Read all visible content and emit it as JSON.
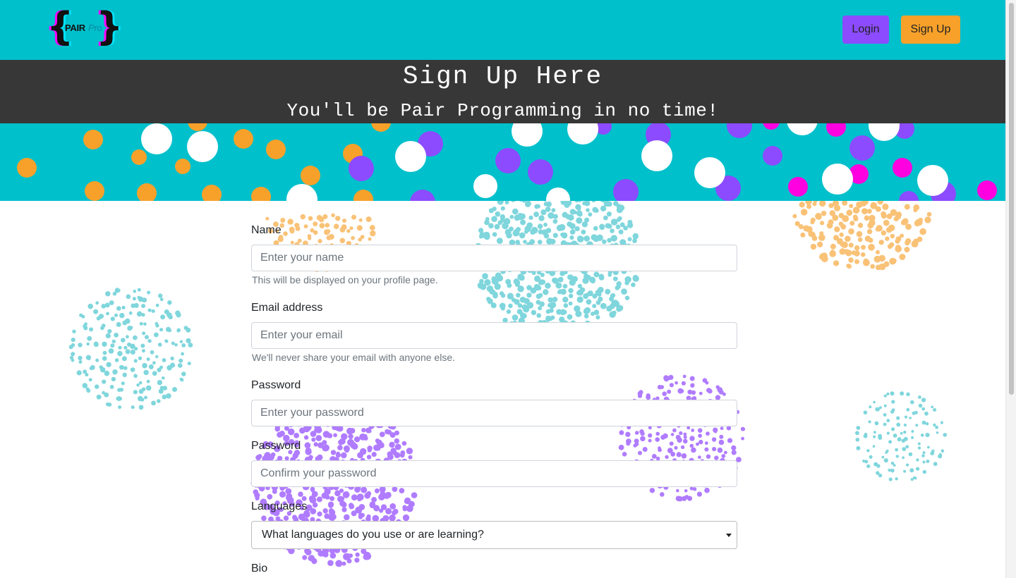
{
  "navbar": {
    "logo": {
      "pair": "PAIR",
      "pro": "Pro"
    },
    "login_label": "Login",
    "signup_label": "Sign Up"
  },
  "hero": {
    "title": "Sign Up Here",
    "subtitle": "You'll be Pair Programming in no time!"
  },
  "form": {
    "name": {
      "label": "Name",
      "placeholder": "Enter your name",
      "help": "This will be displayed on your profile page."
    },
    "email": {
      "label": "Email address",
      "placeholder": "Enter your email",
      "help": "We'll never share your email with anyone else."
    },
    "password": {
      "label": "Password",
      "placeholder": "Enter your password"
    },
    "confirm_password": {
      "label": "Password",
      "placeholder": "Confirm your password"
    },
    "languages": {
      "label": "Languages",
      "selected": "What languages do you use or are learning?"
    },
    "bio": {
      "label": "Bio"
    }
  },
  "colors": {
    "teal": "#00c0cc",
    "dark_band": "#373737",
    "purple": "#8c4bff",
    "orange": "#f7a12a",
    "magenta": "#ff00e0"
  }
}
